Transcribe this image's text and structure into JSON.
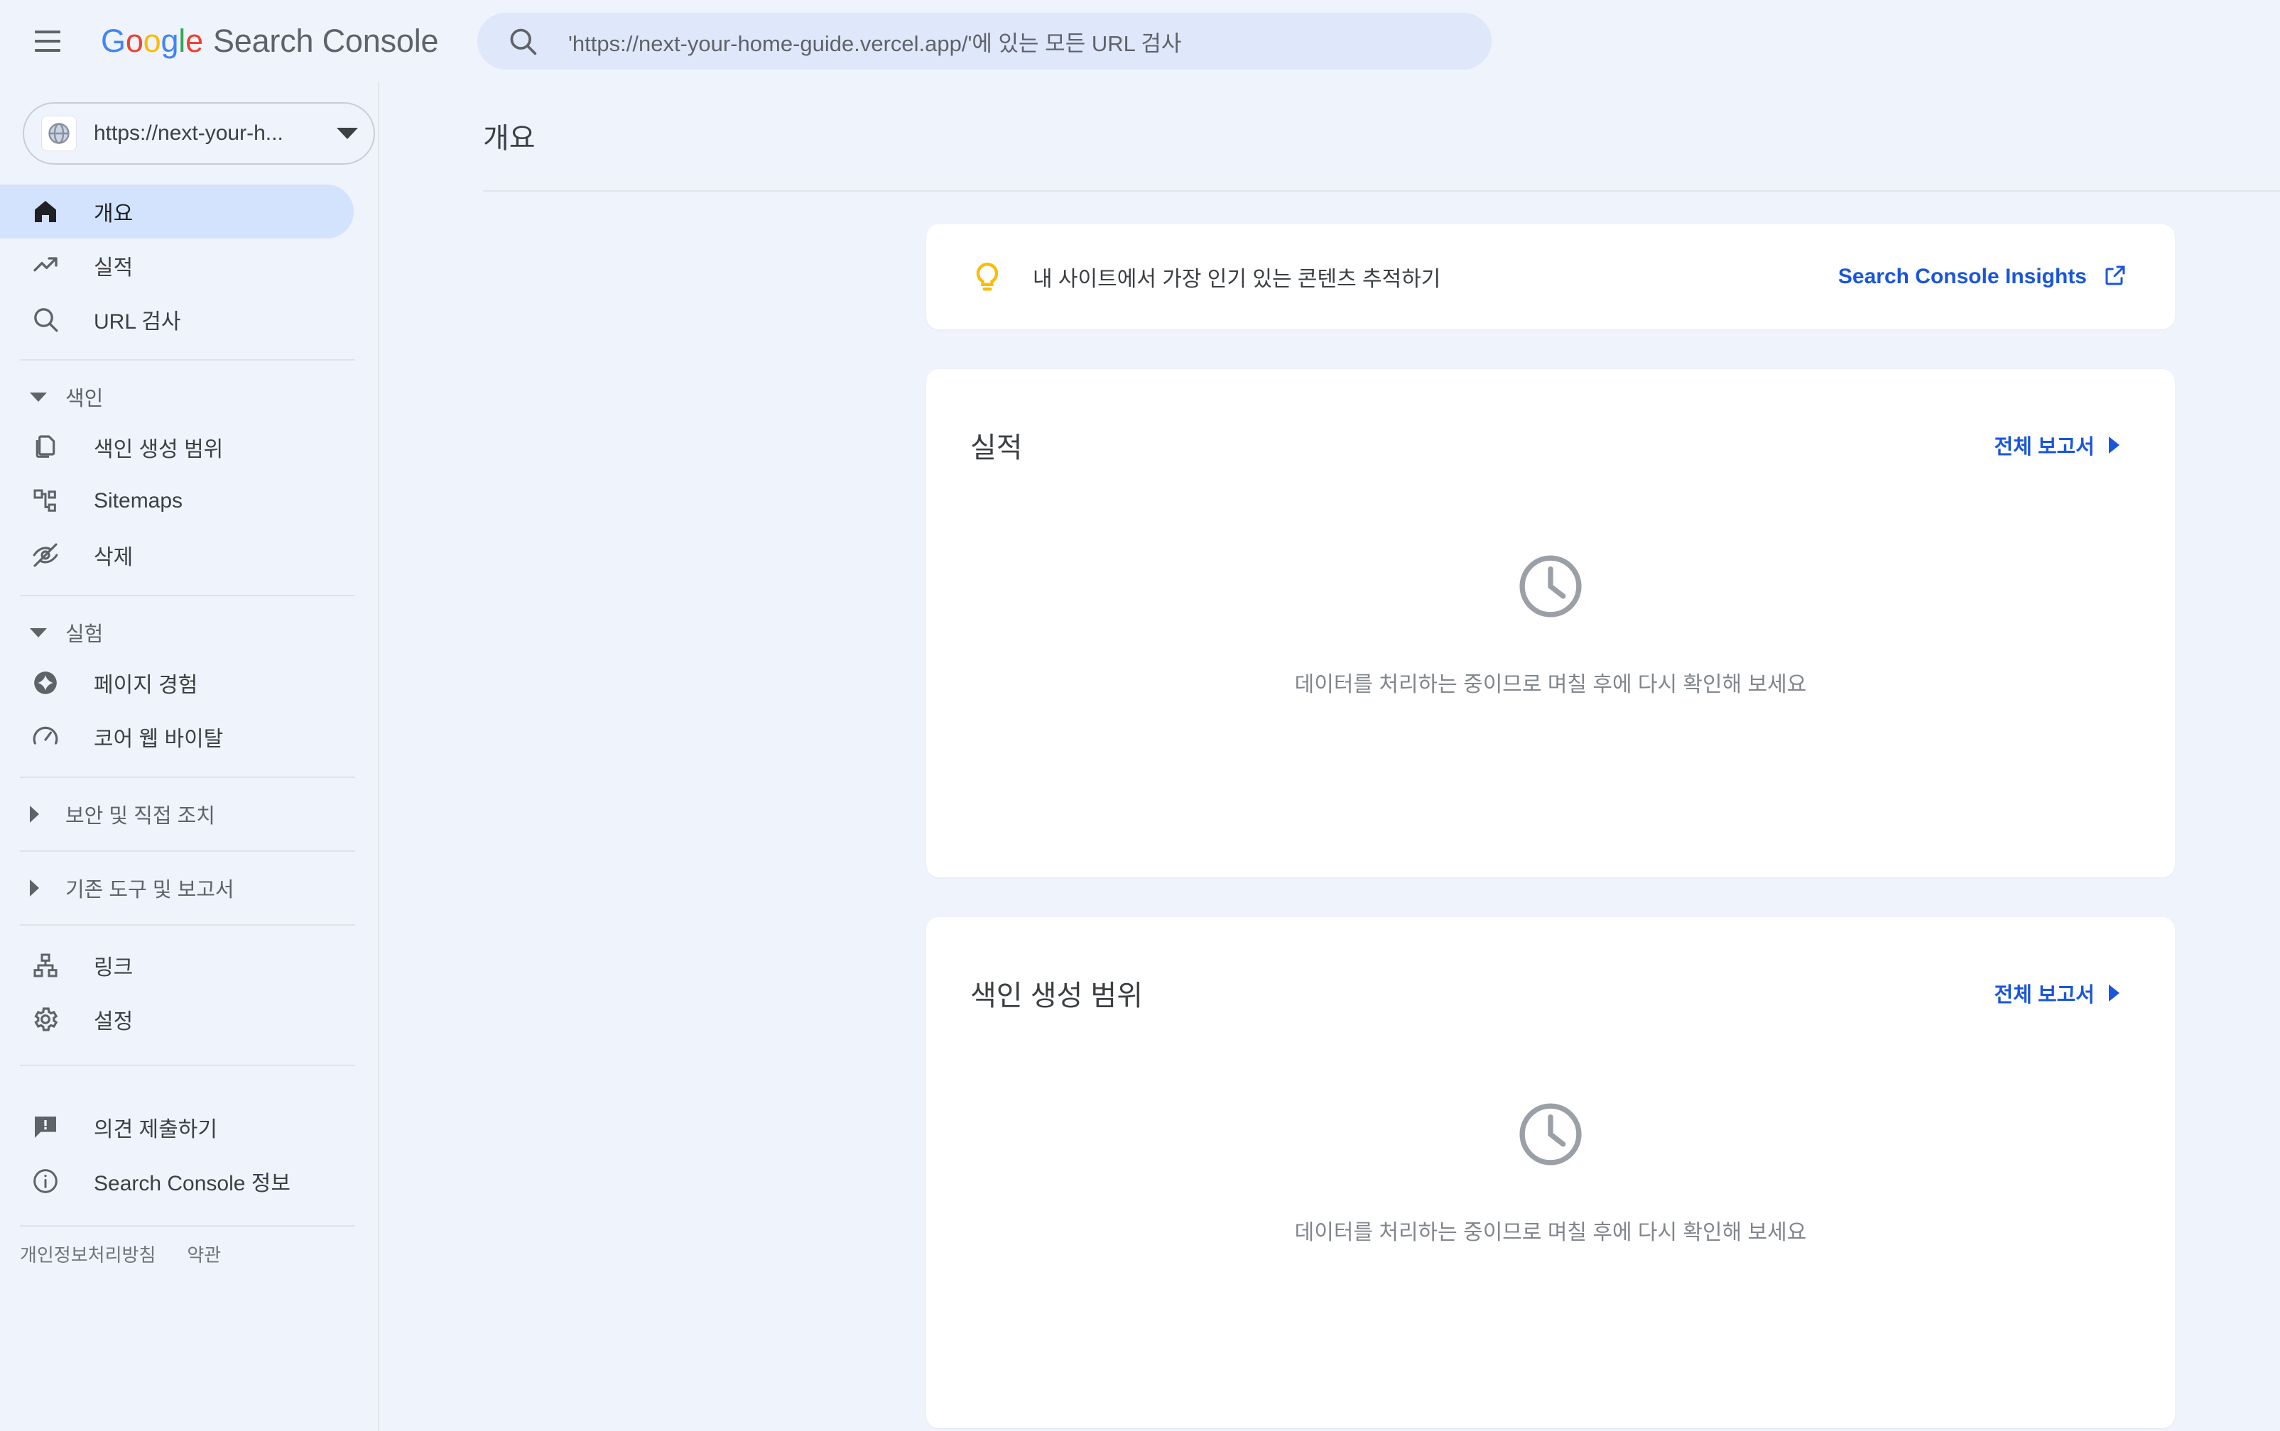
{
  "header": {
    "menu_icon": "hamburger-menu-icon",
    "brand": {
      "g_letters": [
        "G",
        "o",
        "o",
        "g",
        "l",
        "e"
      ],
      "suffix": "Search Console"
    },
    "search": {
      "icon": "search-icon",
      "placeholder": "'https://next-your-home-guide.vercel.app/'에 있는 모든 URL 검사",
      "value": ""
    }
  },
  "sidebar": {
    "property": {
      "icon": "globe-icon",
      "label": "https://next-your-h...",
      "dropdown_icon": "caret-down-icon"
    },
    "primary_items": [
      {
        "label": "개요",
        "icon": "home-icon",
        "active": true
      },
      {
        "label": "실적",
        "icon": "trending-up-icon",
        "active": false
      },
      {
        "label": "URL 검사",
        "icon": "search-icon",
        "active": false
      }
    ],
    "sections": [
      {
        "label": "색인",
        "expanded": true,
        "items": [
          {
            "label": "색인 생성 범위",
            "icon": "pages-copy-icon"
          },
          {
            "label": "Sitemaps",
            "icon": "sitemap-tree-icon"
          },
          {
            "label": "삭제",
            "icon": "eye-off-icon"
          }
        ]
      },
      {
        "label": "실험",
        "expanded": true,
        "items": [
          {
            "label": "페이지 경험",
            "icon": "sparkle-diamond-icon"
          },
          {
            "label": "코어 웹 바이탈",
            "icon": "speedometer-icon"
          }
        ]
      },
      {
        "label": "보안 및 직접 조치",
        "expanded": false,
        "items": []
      },
      {
        "label": "기존 도구 및 보고서",
        "expanded": false,
        "items": []
      }
    ],
    "bottom_items": [
      {
        "label": "링크",
        "icon": "link-tree-icon"
      },
      {
        "label": "설정",
        "icon": "gear-icon"
      }
    ],
    "support_items": [
      {
        "label": "의견 제출하기",
        "icon": "feedback-icon"
      },
      {
        "label": "Search Console 정보",
        "icon": "info-circle-icon"
      }
    ],
    "legal_links": [
      "개인정보처리방침",
      "약관"
    ]
  },
  "main": {
    "page_title": "개요",
    "insights_banner": {
      "icon": "lightbulb-icon",
      "text": "내 사이트에서 가장 인기 있는 콘텐츠 추적하기",
      "link_label": "Search Console Insights",
      "link_icon": "external-link-icon"
    },
    "cards": [
      {
        "title": "실적",
        "action_label": "전체 보고서",
        "action_icon": "chevron-right-icon",
        "empty_icon": "clock-icon",
        "empty_message": "데이터를 처리하는 중이므로 며칠 후에 다시 확인해 보세요"
      },
      {
        "title": "색인 생성 범위",
        "action_label": "전체 보고서",
        "action_icon": "chevron-right-icon",
        "empty_icon": "clock-icon",
        "empty_message": "데이터를 처리하는 중이므로 며칠 후에 다시 확인해 보세요"
      }
    ]
  },
  "colors": {
    "background": "#eff3fc",
    "card": "#ffffff",
    "active_nav": "#d3e3fd",
    "link_blue": "#1a56db",
    "accent_yellow": "#fbbc04",
    "text_primary": "#3c4043",
    "text_secondary": "#5f6368",
    "text_muted": "#80868b",
    "search_field": "#dfe7fa"
  }
}
